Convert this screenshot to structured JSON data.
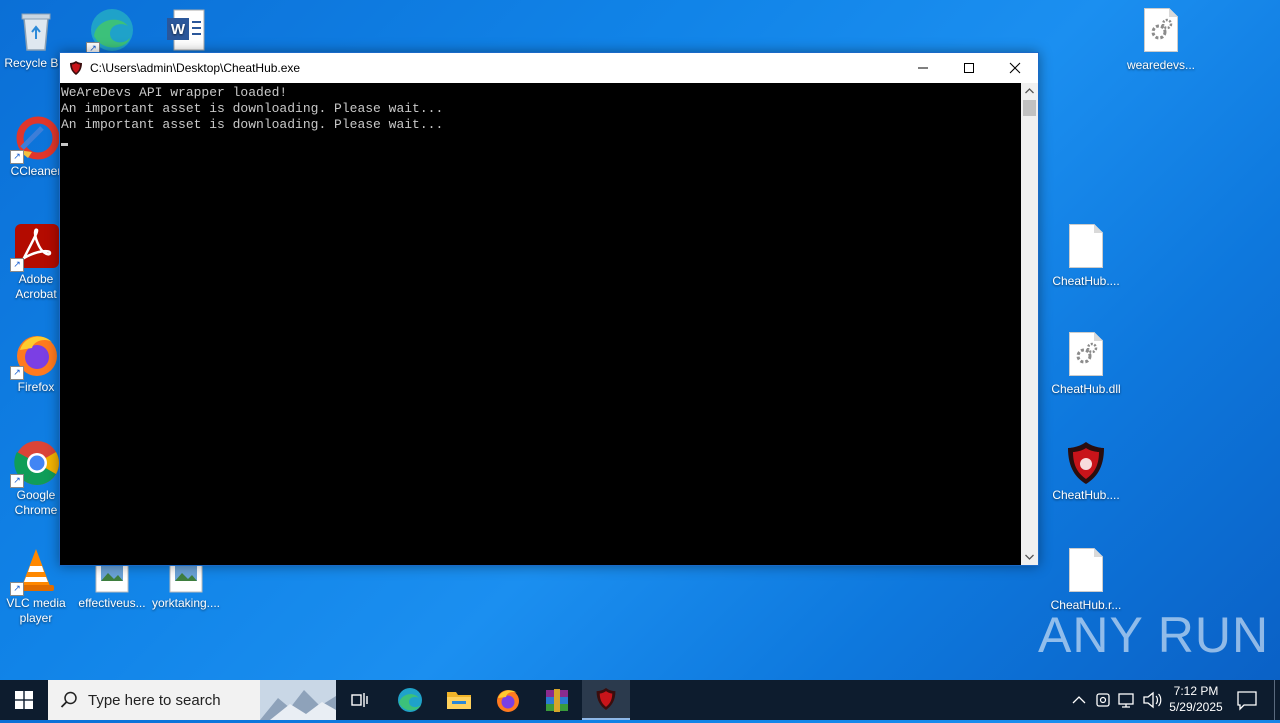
{
  "desktop": {
    "icons_left": [
      {
        "label": "Recycle Bin"
      },
      {
        "label": "CCleaner"
      },
      {
        "label": "Adobe Acrobat"
      },
      {
        "label": "Firefox"
      },
      {
        "label": "Google Chrome"
      },
      {
        "label": "VLC media player"
      }
    ],
    "icons_bottom": [
      {
        "label": "effectiveus..."
      },
      {
        "label": "yorktaking...."
      }
    ],
    "icons_right": [
      {
        "label": "wearedevs..."
      },
      {
        "label": "CheatHub...."
      },
      {
        "label": "CheatHub.dll"
      },
      {
        "label": "CheatHub...."
      },
      {
        "label": "CheatHub.r..."
      }
    ]
  },
  "window": {
    "title": "C:\\Users\\admin\\Desktop\\CheatHub.exe",
    "console_lines": [
      "WeAreDevs API wrapper loaded!",
      "An important asset is downloading. Please wait...",
      "An important asset is downloading. Please wait..."
    ]
  },
  "taskbar": {
    "search_placeholder": "Type here to search",
    "time": "7:12 PM",
    "date": "5/29/2025"
  },
  "watermark": "ANY RUN",
  "colors": {
    "desktop_blue": "#1184e8",
    "taskbar": "#0d1c2e",
    "console_bg": "#000000",
    "console_text": "#c8c8c8"
  }
}
